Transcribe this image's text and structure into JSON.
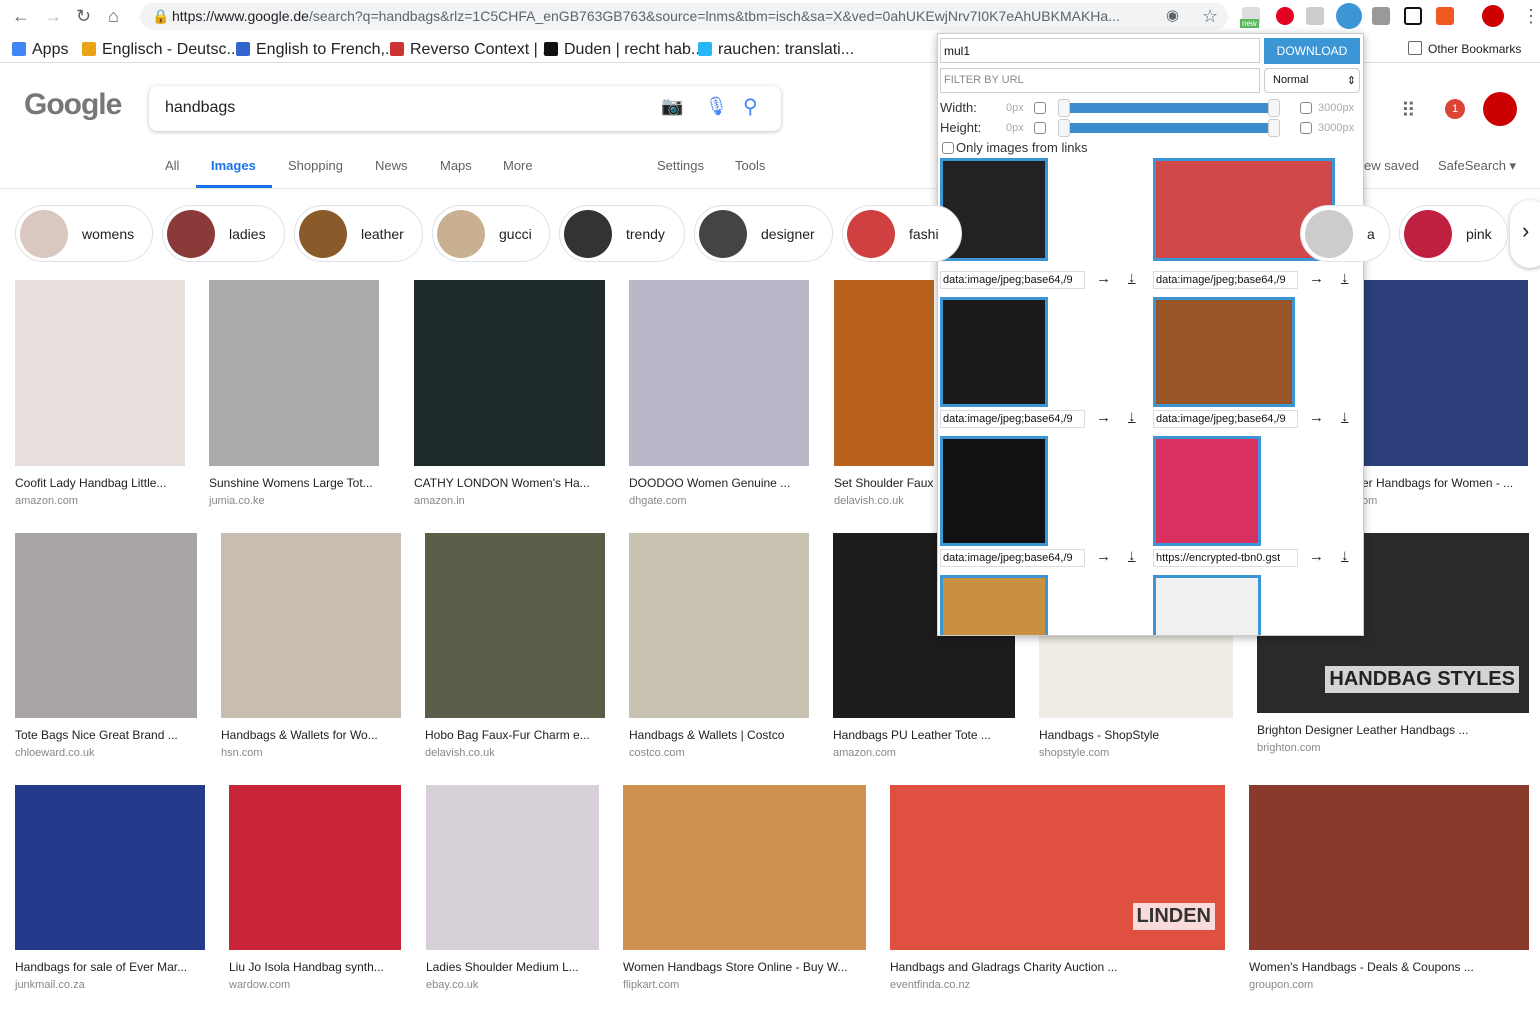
{
  "browser": {
    "url_host": "https://www.google.de",
    "url_rest": "/search?q=handbags&rlz=1C5CHFA_enGB763GB763&source=lnms&tbm=isch&sa=X&ved=0ahUKEwjNrv7I0K7eAhUBKMAKHa...",
    "ext_new_badge": "new",
    "notif_count": "1"
  },
  "bookmarks": [
    {
      "label": "Apps",
      "color": "#4285f4"
    },
    {
      "label": "Englisch - Deutsc...",
      "color": "#e8a317"
    },
    {
      "label": "English to French,...",
      "color": "#3366cc"
    },
    {
      "label": "Reverso Context | ...",
      "color": "#cc3333"
    },
    {
      "label": "Duden | recht hab...",
      "color": "#111111"
    },
    {
      "label": "rauchen: translati...",
      "color": "#29b6f6"
    }
  ],
  "other_bookmarks": "Other Bookmarks",
  "google": {
    "logo": "Google",
    "query": "handbags",
    "tabs": [
      "All",
      "Images",
      "Shopping",
      "News",
      "Maps",
      "More"
    ],
    "settings": "Settings",
    "tools": "Tools",
    "view_saved": "ew saved",
    "safesearch": "SafeSearch"
  },
  "chips": [
    {
      "label": "womens",
      "color": "#d8c8c0"
    },
    {
      "label": "ladies",
      "color": "#8b3a3a"
    },
    {
      "label": "leather",
      "color": "#8b5a2b"
    },
    {
      "label": "gucci",
      "color": "#c8b090"
    },
    {
      "label": "trendy",
      "color": "#333333"
    },
    {
      "label": "designer",
      "color": "#444444"
    },
    {
      "label": "fashi",
      "color": "#d04040"
    },
    {
      "label": "a",
      "color": "#cccccc"
    },
    {
      "label": "pink",
      "color": "#c02040"
    }
  ],
  "results": [
    {
      "caption": "Coofit Lady Handbag Little...",
      "source": "amazon.com",
      "color": "#e8e0dc"
    },
    {
      "caption": "Sunshine Womens Large Tot...",
      "source": "jumia.co.ke",
      "color": "#a8aba8"
    },
    {
      "caption": "CATHY LONDON Women's Ha...",
      "source": "amazon.in",
      "color": "#1f2a2a"
    },
    {
      "caption": "DOODOO Women Genuine ...",
      "source": "dhgate.com",
      "color": "#b8b8c8"
    },
    {
      "caption": "Set Shoulder Faux",
      "source": "delavish.co.uk",
      "color": "#b8621e"
    },
    {
      "caption": "er Handbags for Women - ...",
      "source": "om",
      "color": "#2d3f7a"
    },
    {
      "caption": "Tote Bags Nice Great Brand ...",
      "source": "chloeward.co.uk",
      "color": "#a9a4a6"
    },
    {
      "caption": "Handbags & Wallets for Wo...",
      "source": "hsn.com",
      "color": "#c9bcb0"
    },
    {
      "caption": "Hobo Bag Faux-Fur Charm e...",
      "source": "delavish.co.uk",
      "color": "#5a5e48"
    },
    {
      "caption": "Handbags & Wallets | Costco",
      "source": "costco.com",
      "color": "#c8c2b2"
    },
    {
      "caption": "Handbags PU Leather Tote ...",
      "source": "amazon.com",
      "color": "#1c1c1c"
    },
    {
      "caption": "Handbags - ShopStyle",
      "source": "shopstyle.com",
      "color": "#f0ece6"
    },
    {
      "caption": "Brighton Designer Leather Handbags ...",
      "source": "brighton.com",
      "color": "#2a2a2a",
      "overlay": "HANDBAG STYLES"
    },
    {
      "caption": "Handbags for sale of Ever Mar...",
      "source": "junkmail.co.za",
      "color": "#243a8a"
    },
    {
      "caption": "Liu Jo Isola Handbag synth...",
      "source": "wardow.com",
      "color": "#c8243a"
    },
    {
      "caption": "Ladies Shoulder Medium L...",
      "source": "ebay.co.uk",
      "color": "#d8d0d8"
    },
    {
      "caption": "Women Handbags Store Online - Buy W...",
      "source": "flipkart.com",
      "color": "#d09050"
    },
    {
      "caption": "Handbags and Gladrags Charity Auction ...",
      "source": "eventfinda.co.nz",
      "color": "#e05040",
      "overlay": "LINDEN"
    },
    {
      "caption": "Women's Handbags - Deals & Coupons ...",
      "source": "groupon.com",
      "color": "#8a3a2a"
    }
  ],
  "popup": {
    "folder": "mul1",
    "download": "DOWNLOAD",
    "filter_placeholder": "FILTER BY URL",
    "mode": "Normal",
    "width_label": "Width:",
    "height_label": "Height:",
    "min": "0px",
    "max": "3000px",
    "width_range": [
      0,
      3000
    ],
    "height_range": [
      0,
      3000
    ],
    "only_links": "Only images from links",
    "images": [
      {
        "url": "data:image/jpeg;base64,/9",
        "color": "#222222"
      },
      {
        "url": "data:image/jpeg;base64,/9",
        "color": "#d04848"
      },
      {
        "url": "data:image/jpeg;base64,/9",
        "color": "#1a1a1a"
      },
      {
        "url": "data:image/jpeg;base64,/9",
        "color": "#9a5628"
      },
      {
        "url": "data:image/jpeg;base64,/9",
        "color": "#111111"
      },
      {
        "url": "https://encrypted-tbn0.gst",
        "color": "#d83060"
      },
      {
        "url": "",
        "color": "#c89040"
      },
      {
        "url": "",
        "color": "#f0f0f0"
      }
    ]
  }
}
